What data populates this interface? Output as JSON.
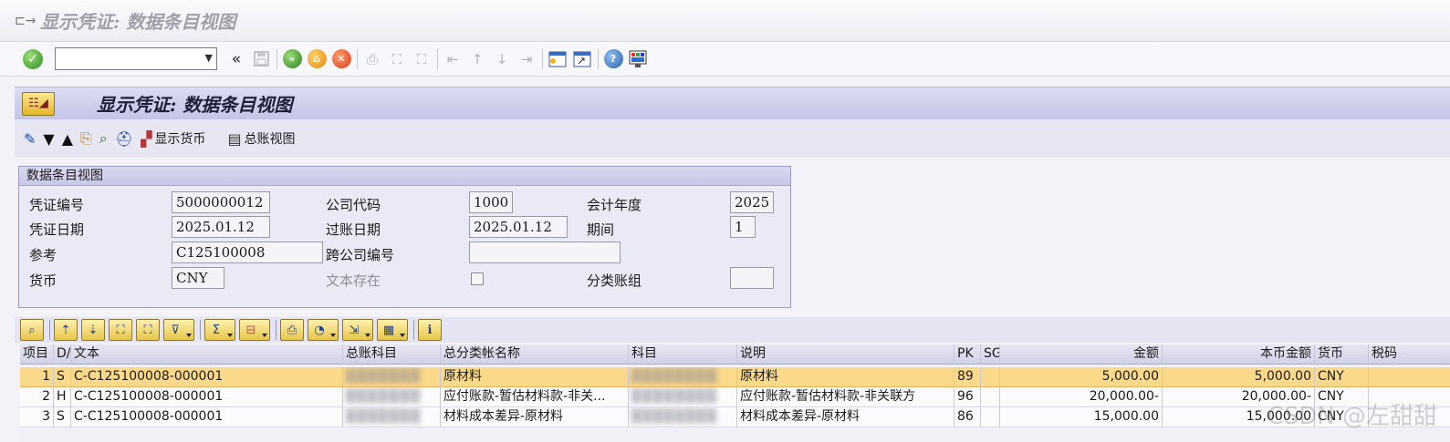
{
  "window": {
    "title": "显示凭证: 数据条目视图"
  },
  "system_toolbar": {
    "command_field_value": "",
    "icons": [
      "enter-icon",
      "back-icon",
      "save-icon",
      "green-back-icon",
      "exit-icon",
      "cancel-icon",
      "print-icon",
      "find-icon",
      "find-next-icon",
      "first-page-icon",
      "prev-page-icon",
      "next-page-icon",
      "last-page-icon",
      "new-session-icon",
      "shortcut-icon",
      "help-icon",
      "customize-layout-icon"
    ],
    "double_arrow": "«"
  },
  "app": {
    "title": "显示凭证: 数据条目视图",
    "toolbar": {
      "display_currency_label": "显示货币",
      "ledger_view_label": "总账视图"
    }
  },
  "group": {
    "title": "数据条目视图",
    "fields": {
      "doc_number_label": "凭证编号",
      "doc_number": "5000000012",
      "company_code_label": "公司代码",
      "company_code": "1000",
      "fiscal_year_label": "会计年度",
      "fiscal_year": "2025",
      "doc_date_label": "凭证日期",
      "doc_date": "2025.01.12",
      "posting_date_label": "过账日期",
      "posting_date": "2025.01.12",
      "period_label": "期间",
      "period": "1",
      "reference_label": "参考",
      "reference": "C125100008",
      "intercompany_label": "跨公司编号",
      "intercompany": "",
      "currency_label": "货币",
      "currency": "CNY",
      "text_exists_label": "文本存在",
      "ledger_group_label": "分类账组",
      "ledger_group": ""
    }
  },
  "table": {
    "headers": [
      "项目",
      "D/",
      "文本",
      "总账科目",
      "总分类帐名称",
      "科目",
      "说明",
      "PK",
      "SG",
      "金额",
      "本币金额",
      "货币",
      "税码"
    ],
    "rows": [
      {
        "item": "1",
        "dc": "S",
        "text": "C-C125100008-000001",
        "gl": "▒▒▒▒▒▒▒",
        "gl_name": "原材料",
        "account": "▒▒▒▒▒▒▒▒",
        "desc": "原材料",
        "pk": "89",
        "sg": "",
        "amount": "5,000.00",
        "local_amount": "5,000.00",
        "currency": "CNY",
        "tax": ""
      },
      {
        "item": "2",
        "dc": "H",
        "text": "C-C125100008-000001",
        "gl": "▒▒▒▒▒▒▒",
        "gl_name": "应付账款-暂估材料款-非关...",
        "account": "▒▒▒▒▒▒▒▒",
        "desc": "应付账款-暂估材料款-非关联方",
        "pk": "96",
        "sg": "",
        "amount": "20,000.00-",
        "local_amount": "20,000.00-",
        "currency": "CNY",
        "tax": ""
      },
      {
        "item": "3",
        "dc": "S",
        "text": "C-C125100008-000001",
        "gl": "▒▒▒▒▒▒▒",
        "gl_name": "材料成本差异-原材料",
        "account": "▒▒▒▒▒▒▒▒",
        "desc": "材料成本差异-原材料",
        "pk": "86",
        "sg": "",
        "amount": "15,000.00",
        "local_amount": "15,000.00",
        "currency": "CNY",
        "tax": ""
      }
    ]
  },
  "watermark": "CSDN @左甜甜"
}
